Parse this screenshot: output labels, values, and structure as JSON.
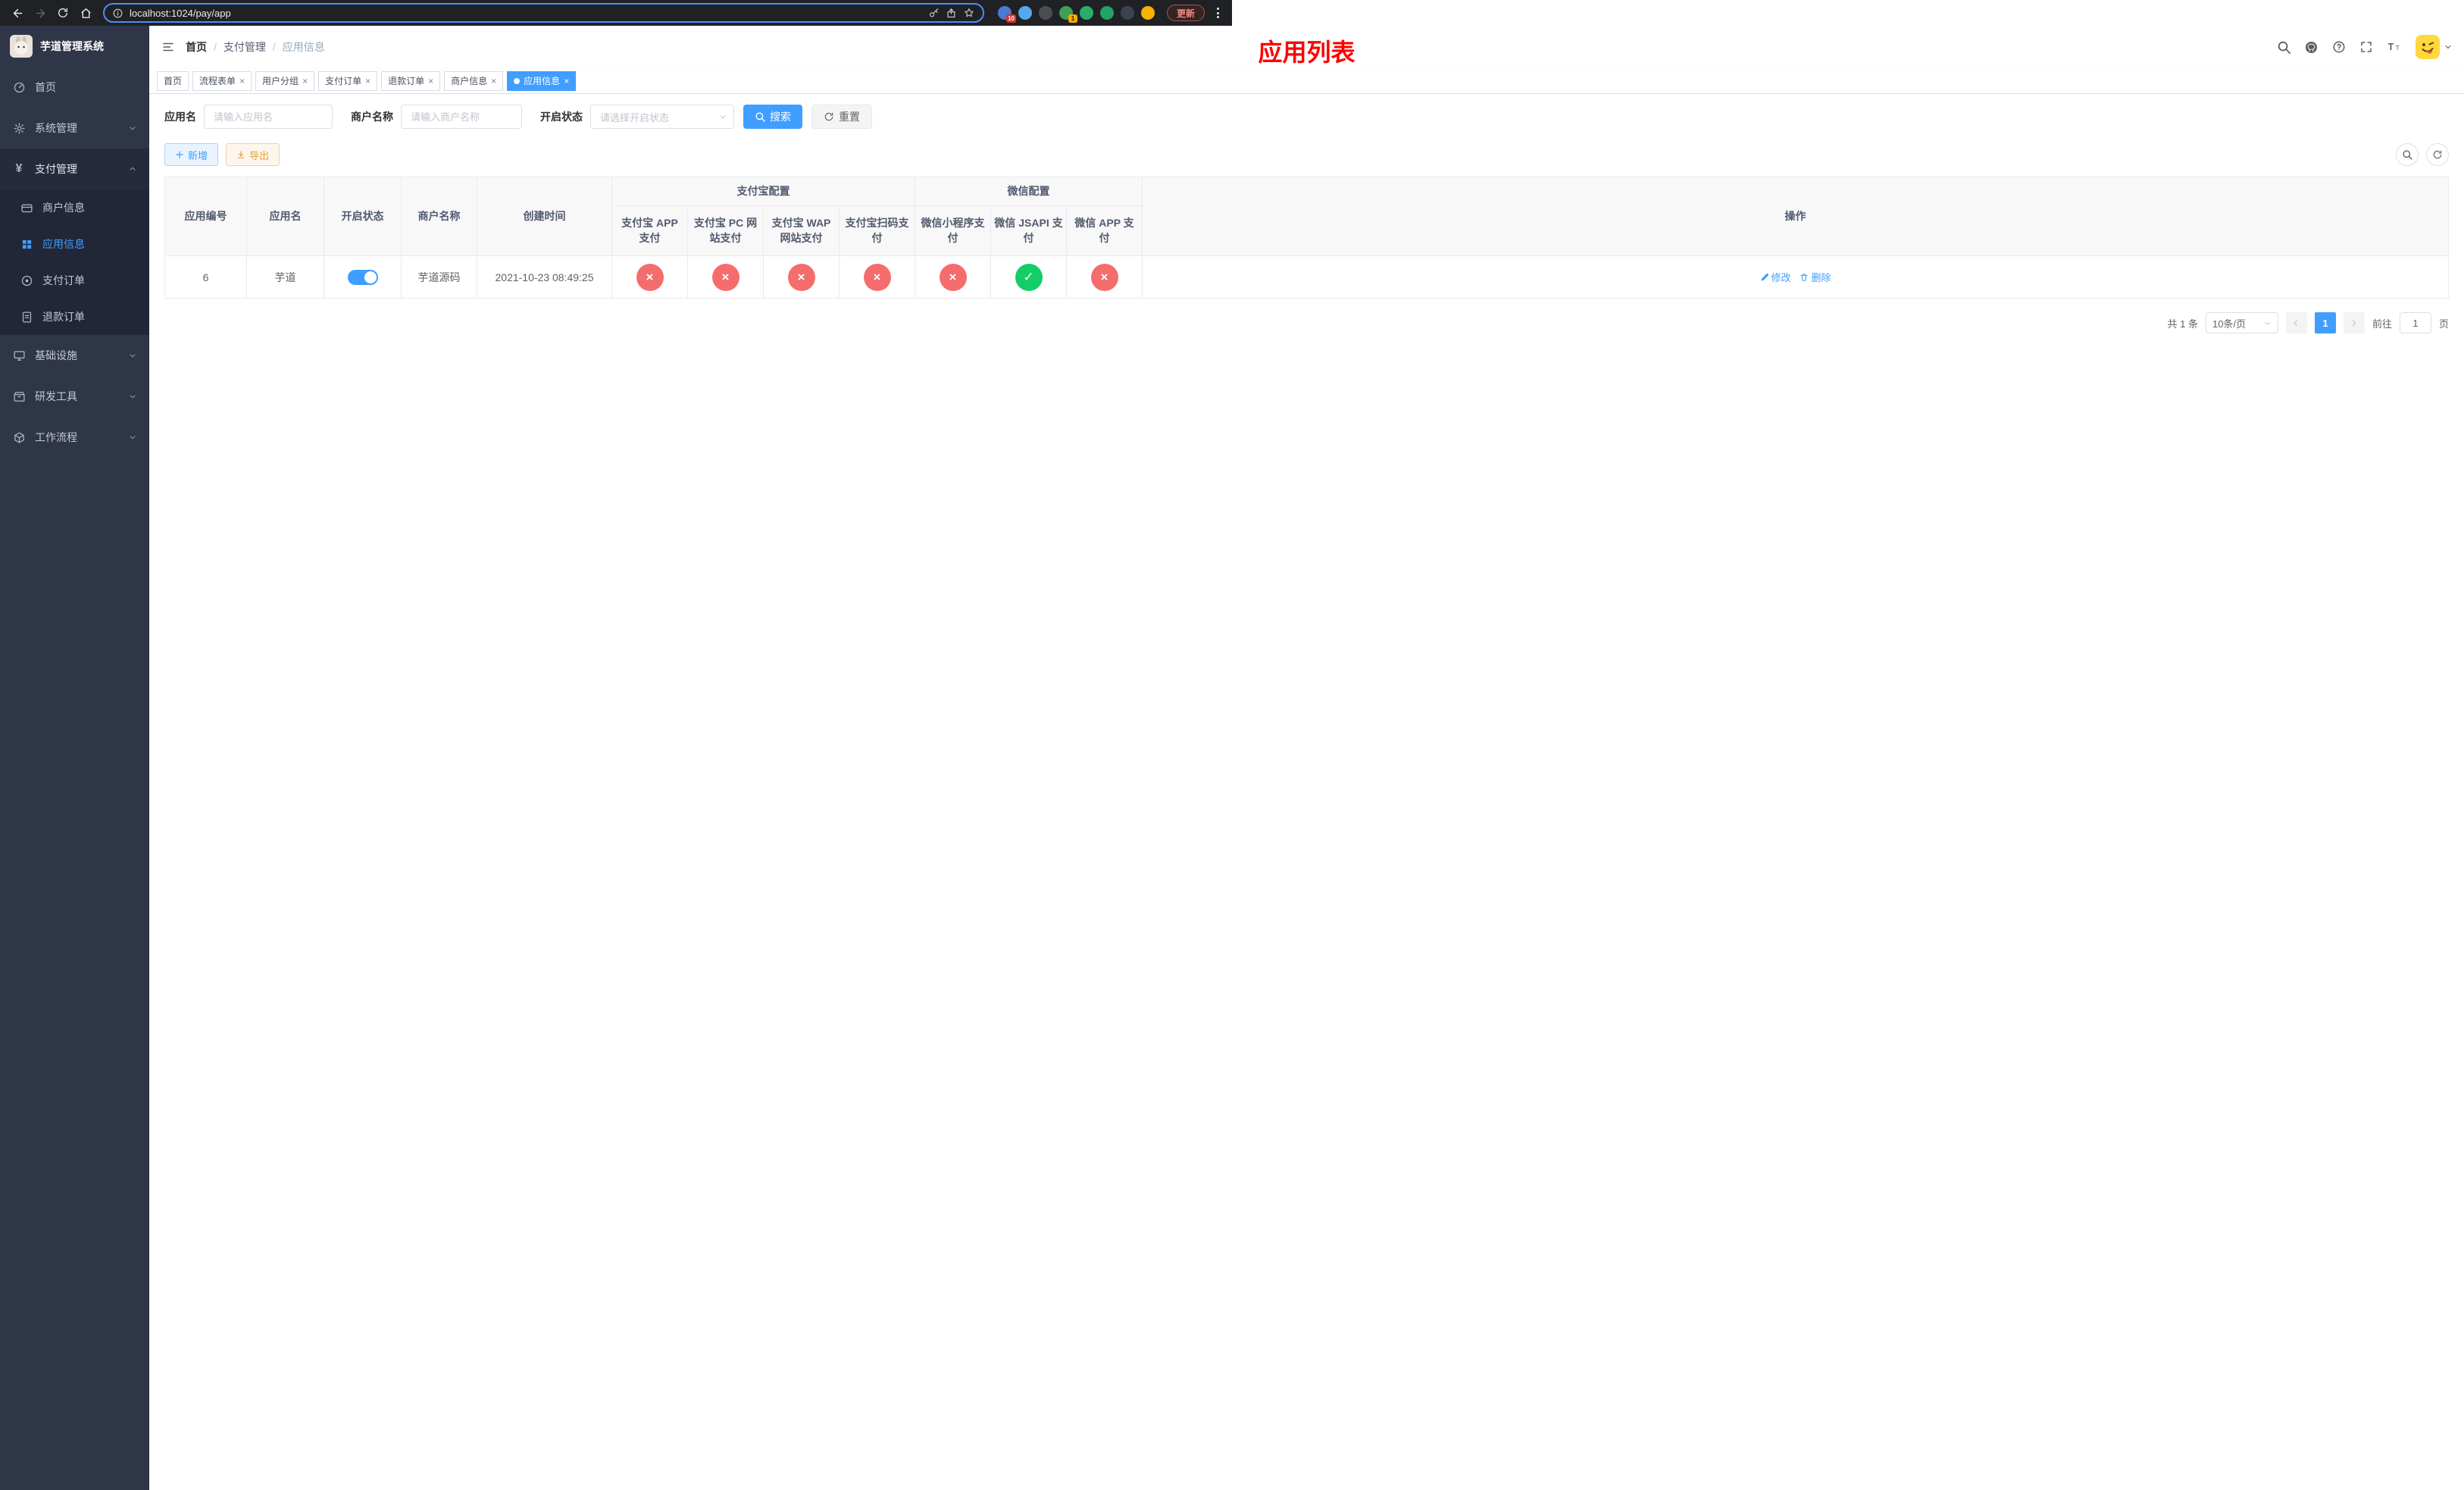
{
  "colors": {
    "primary": "#409eff",
    "danger": "#f56c6c",
    "success": "#13ce66",
    "title_red": "#ff0000"
  },
  "browser": {
    "url": "localhost:1024/pay/app",
    "update_label": "更新",
    "ext_badge_1": "10",
    "ext_badge_2": "1"
  },
  "sidebar": {
    "title": "芋道管理系统",
    "items": {
      "home": "首页",
      "system": "系统管理",
      "payment": "支付管理",
      "infra": "基础设施",
      "devtools": "研发工具",
      "workflow": "工作流程"
    },
    "payment_children": {
      "merchant": "商户信息",
      "app": "应用信息",
      "order": "支付订单",
      "refund": "退款订单"
    }
  },
  "header": {
    "breadcrumb_home": "首页",
    "breadcrumb_section": "支付管理",
    "breadcrumb_current": "应用信息",
    "overlay_title": "应用列表"
  },
  "tabs": [
    {
      "label": "首页"
    },
    {
      "label": "流程表单"
    },
    {
      "label": "用户分组"
    },
    {
      "label": "支付订单"
    },
    {
      "label": "退款订单"
    },
    {
      "label": "商户信息"
    },
    {
      "label": "应用信息"
    }
  ],
  "filters": {
    "app_name_label": "应用名",
    "app_name_placeholder": "请输入应用名",
    "merchant_label": "商户名称",
    "merchant_placeholder": "请输入商户名称",
    "status_label": "开启状态",
    "status_placeholder": "请选择开启状态",
    "search_label": "搜索",
    "reset_label": "重置"
  },
  "toolbar": {
    "add_label": "新增",
    "export_label": "导出"
  },
  "table": {
    "col_id": "应用编号",
    "col_name": "应用名",
    "col_status": "开启状态",
    "col_merchant": "商户名称",
    "col_created": "创建时间",
    "group_alipay": "支付宝配置",
    "group_wechat": "微信配置",
    "col_alipay_app": "支付宝 APP 支付",
    "col_alipay_pc": "支付宝 PC 网站支付",
    "col_alipay_wap": "支付宝 WAP 网站支付",
    "col_alipay_qr": "支付宝扫码支付",
    "col_wx_mini": "微信小程序支付",
    "col_wx_jsapi": "微信 JSAPI 支付",
    "col_wx_app": "微信 APP 支付",
    "col_ops": "操作",
    "row": {
      "id": "6",
      "name": "芋道",
      "status_on": true,
      "merchant": "芋道源码",
      "created": "2021-10-23 08:49:25",
      "alipay_app": false,
      "alipay_pc": false,
      "alipay_wap": false,
      "alipay_qr": false,
      "wx_mini": false,
      "wx_jsapi": true,
      "wx_app": false,
      "edit_label": "修改",
      "delete_label": "删除"
    }
  },
  "pagination": {
    "total": "共 1 条",
    "page_size": "10条/页",
    "page": "1",
    "goto_label": "前往",
    "goto_value": "1",
    "goto_unit": "页"
  }
}
